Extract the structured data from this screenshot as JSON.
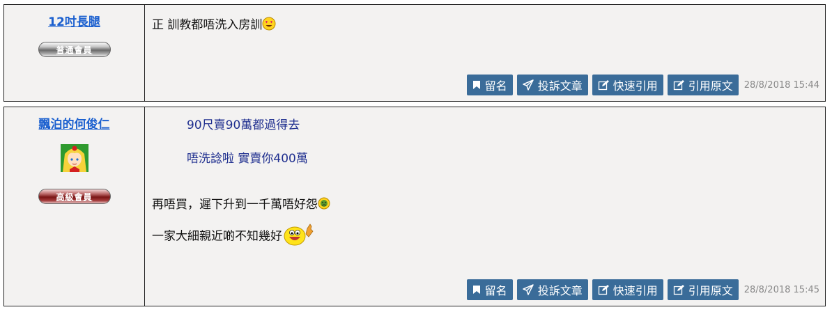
{
  "posts": [
    {
      "author": "12吋長腿",
      "rank": "普通會員",
      "message": "正 訓教都唔洗入房訓",
      "buttons": {
        "bookmark": "留名",
        "report": "投訴文章",
        "quick_quote": "快速引用",
        "quote_original": "引用原文"
      },
      "timestamp": "28/8/2018 15:44"
    },
    {
      "author": "飄泊的何俊仁",
      "rank": "高級會員",
      "quote_lines": [
        "90尺賣90萬都過得去",
        "唔洗諗啦 實賣你400萬"
      ],
      "message_lines": [
        "再唔買，遲下升到一千萬唔好怨",
        "一家大細親近啲不知幾好"
      ],
      "buttons": {
        "bookmark": "留名",
        "report": "投訴文章",
        "quick_quote": "快速引用",
        "quote_original": "引用原文"
      },
      "timestamp": "28/8/2018 15:45"
    }
  ],
  "colors": {
    "button_bg": "#3a6c99",
    "link": "#1a5fcf",
    "quote_text": "#1f2f8f",
    "post_bg": "#f3f2f1"
  }
}
